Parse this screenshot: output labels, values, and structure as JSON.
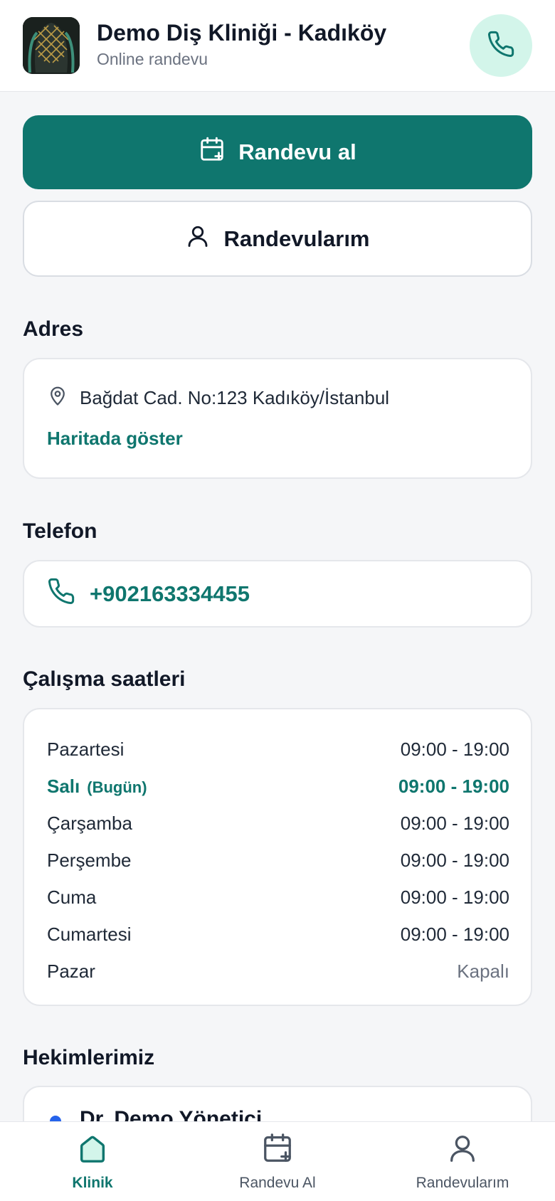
{
  "header": {
    "title": "Demo Diş Kliniği - Kadıköy",
    "subtitle": "Online randevu"
  },
  "actions": {
    "book_label": "Randevu al",
    "my_appointments_label": "Randevularım"
  },
  "address": {
    "section_title": "Adres",
    "text": "Bağdat Cad. No:123 Kadıköy/İstanbul",
    "map_link": "Haritada göster"
  },
  "phone": {
    "section_title": "Telefon",
    "number": "+902163334455"
  },
  "hours": {
    "section_title": "Çalışma saatleri",
    "today_badge": "(Bugün)",
    "rows": [
      {
        "day": "Pazartesi",
        "time": "09:00 - 19:00"
      },
      {
        "day": "Salı",
        "time": "09:00 - 19:00"
      },
      {
        "day": "Çarşamba",
        "time": "09:00 - 19:00"
      },
      {
        "day": "Perşembe",
        "time": "09:00 - 19:00"
      },
      {
        "day": "Cuma",
        "time": "09:00 - 19:00"
      },
      {
        "day": "Cumartesi",
        "time": "09:00 - 19:00"
      },
      {
        "day": "Pazar",
        "time": "Kapalı"
      }
    ]
  },
  "doctors": {
    "section_title": "Hekimlerimiz",
    "first_name": "Dr. Demo Yönetici"
  },
  "nav": {
    "items": [
      {
        "label": "Klinik",
        "active": true
      },
      {
        "label": "Randevu Al",
        "active": false
      },
      {
        "label": "Randevularım",
        "active": false
      }
    ]
  },
  "colors": {
    "accent": "#0f766e",
    "call_bg": "#d3f5ea",
    "doctor_dot": "#2563eb"
  },
  "icons": {
    "call": "phone-icon",
    "book": "calendar-plus-icon",
    "user": "user-icon",
    "location": "map-pin-icon",
    "home": "home-icon"
  }
}
